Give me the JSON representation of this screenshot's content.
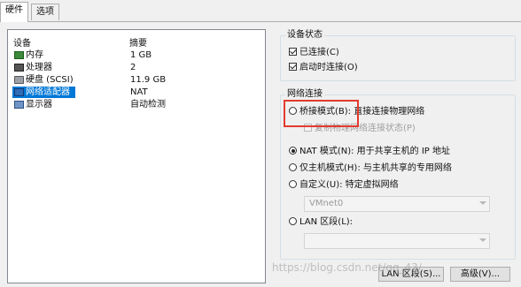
{
  "tabs": [
    {
      "label": "硬件",
      "active": true
    },
    {
      "label": "选项",
      "active": false
    }
  ],
  "device_list": {
    "headers": {
      "device": "设备",
      "summary": "摘要"
    },
    "rows": [
      {
        "name": "内存",
        "value": "1 GB",
        "icon": "memory-icon"
      },
      {
        "name": "处理器",
        "value": "2",
        "icon": "processor-icon"
      },
      {
        "name": "硬盘 (SCSI)",
        "value": "11.9 GB",
        "icon": "hard-disk-icon"
      },
      {
        "name": "网络适配器",
        "value": "NAT",
        "icon": "network-adapter-icon",
        "selected": true
      },
      {
        "name": "显示器",
        "value": "自动检测",
        "icon": "display-icon"
      }
    ]
  },
  "device_status": {
    "title": "设备状态",
    "connected": {
      "label": "已连接(C)",
      "checked": true
    },
    "connect_at_power_on": {
      "label": "启动时连接(O)",
      "checked": true
    }
  },
  "network_connection": {
    "title": "网络连接",
    "bridged": {
      "label": "桥接模式(B): 直接连接物理网络",
      "checked": false
    },
    "replicate": {
      "label": "复制物理网络连接状态(P)",
      "checked": false,
      "disabled": true
    },
    "nat": {
      "label": "NAT 模式(N): 用于共享主机的 IP 地址",
      "checked": true
    },
    "host_only": {
      "label": "仅主机模式(H): 与主机共享的专用网络",
      "checked": false
    },
    "custom": {
      "label": "自定义(U): 特定虚拟网络",
      "checked": false
    },
    "custom_select_value": "VMnet0",
    "lan_segment": {
      "label": "LAN 区段(L):",
      "checked": false
    },
    "lan_select_value": ""
  },
  "buttons": {
    "lan_segments": "LAN 区段(S)...",
    "advanced": "高级(V)..."
  },
  "watermark": "https://blog.csdn.net/qq_43/"
}
